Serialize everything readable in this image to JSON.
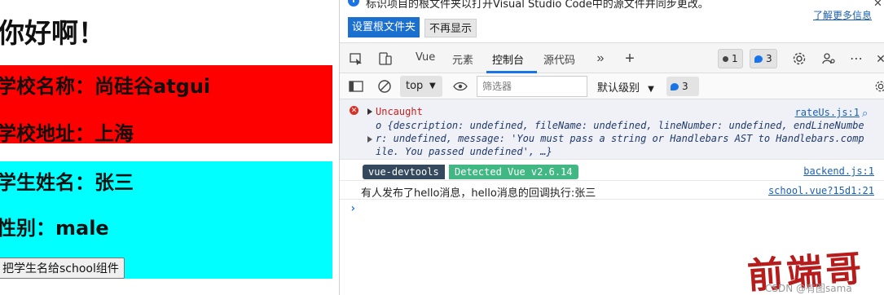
{
  "page": {
    "heading": "你好啊！",
    "school_name": "学校名称：尚硅谷atgui",
    "school_address": "学校地址：上海",
    "student_name": "学生姓名：张三",
    "student_gender": "性别：male",
    "send_button": "把学生名给school组件"
  },
  "infobar": {
    "icon": "info-icon",
    "message": "标识项目的根文件夹以打开Visual Studio Code中的源文件并同步更改。",
    "learn_more": "了解更多信息",
    "primary_button": "设置根文件夹",
    "secondary_button": "不再显示"
  },
  "tabs": {
    "items": [
      "Vue",
      "元素",
      "控制台",
      "源代码"
    ],
    "active": "控制台",
    "errors_count": "1",
    "issues_count": "3"
  },
  "filter": {
    "context": "top",
    "placeholder": "筛选器",
    "levels": "默认级别",
    "issues_count": "3"
  },
  "console": {
    "error": {
      "title": "Uncaught",
      "source": "rateUs.js:1",
      "line1": "o {description: undefined, fileName: undefined, lineNumber: undefined, endLineNumbe",
      "line2": "r: undefined, message: 'You must pass a string or Handlebars AST to Handlebars.comp",
      "line3": "ile. You passed undefined', …}"
    },
    "devtools": {
      "badge_left": "vue-devtools",
      "badge_right": "Detected Vue v2.6.14",
      "source": "backend.js:1"
    },
    "log": {
      "text": "有人发布了hello消息，hello消息的回调执行:张三",
      "source": "school.vue?15d1:21"
    },
    "prompt": "›"
  },
  "watermark": {
    "big": "前端哥",
    "small": "CSDN @有图sama"
  },
  "colors": {
    "school_bg": "#ff0000",
    "student_bg": "#00ffff",
    "accent": "#1a73e8",
    "vue_green": "#41b883",
    "vue_dark": "#35495e"
  }
}
